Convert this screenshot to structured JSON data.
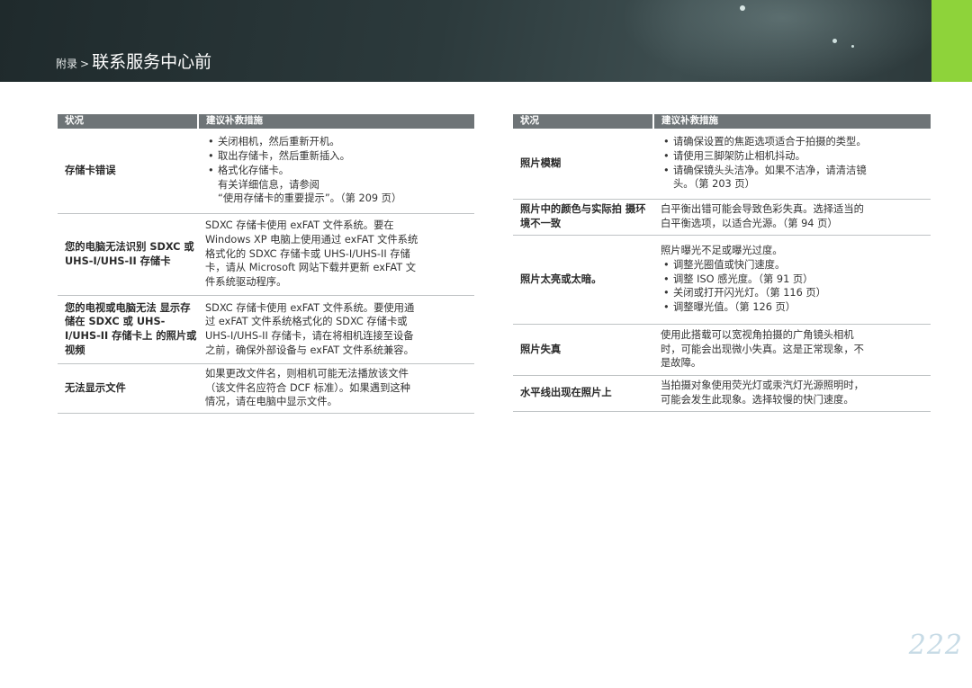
{
  "header": {
    "section": "附录",
    "separator": ">",
    "title": "联系服务中心前"
  },
  "left_table": {
    "col_condition": "状况",
    "col_solution": "建议补救措施",
    "rows": [
      {
        "condition": "存储卡错误",
        "solution": [
          "关闭相机，然后重新开机。",
          "取出存储卡，然后重新插入。",
          "格式化存储卡。",
          "有关详细信息，请参阅",
          "“使用存储卡的重要提示”。（第 209 页）"
        ]
      },
      {
        "condition": [
          "您的电脑无法识别",
          "SDXC 或 UHS-I/UHS-II",
          "存储卡"
        ],
        "solution": [
          "SDXC 存储卡使用 exFAT 文件系统。要在",
          "Windows XP 电脑上使用通过 exFAT 文件系统",
          "格式化的 SDXC 存储卡或 UHS-I/UHS-II 存储",
          "卡，请从 Microsoft 网站下载并更新 exFAT 文",
          "件系统驱动程序。"
        ]
      },
      {
        "condition": [
          "您的电视或电脑无法",
          "显示存储在 SDXC 或",
          "UHS-I/UHS-II 存储卡上",
          "的照片或视频"
        ],
        "solution": [
          "SDXC 存储卡使用 exFAT 文件系统。要使用通",
          "过 exFAT 文件系统格式化的 SDXC 存储卡或",
          "UHS-I/UHS-II 存储卡，请在将相机连接至设备",
          "之前，确保外部设备与 exFAT 文件系统兼容。"
        ]
      },
      {
        "condition": "无法显示文件",
        "solution": [
          "如果更改文件名，则相机可能无法播放该文件",
          "（该文件名应符合 DCF 标准）。如果遇到这种",
          "情况，请在电脑中显示文件。"
        ]
      }
    ]
  },
  "right_table": {
    "col_condition": "状况",
    "col_solution": "建议补救措施",
    "rows": [
      {
        "condition": "照片模糊",
        "solution": [
          "请确保设置的焦距选项适合于拍摄的类型。",
          "请使用三脚架防止相机抖动。",
          "请确保镜头头洁净。如果不洁净，请清洁镜",
          "头。（第 203 页）"
        ]
      },
      {
        "condition": [
          "照片中的颜色与实际拍",
          "摄环境不一致"
        ],
        "solution": [
          "白平衡出错可能会导致色彩失真。选择适当的",
          "白平衡选项，以适合光源。（第 94 页）"
        ]
      },
      {
        "condition": "照片太亮或太暗。",
        "solution": [
          "照片曝光不足或曝光过度。",
          "调整光圈值或快门速度。",
          "调整 ISO 感光度。（第 91 页）",
          "关闭或打开闪光灯。（第 116 页）",
          "调整曝光值。（第 126 页）"
        ]
      },
      {
        "condition": "照片失真",
        "solution": [
          "使用此搭载可以宽视角拍摄的广角镜头相机",
          "时，可能会出现微小失真。这是正常现象，不",
          "是故障。"
        ]
      },
      {
        "condition": "水平线出现在照片上",
        "solution": [
          "当拍摄对象使用荧光灯或汞汽灯光源照明时，",
          "可能会发生此现象。选择较慢的快门速度。"
        ]
      }
    ]
  },
  "page_number": "222",
  "colors": {
    "header_bg": "#2c3a3c",
    "accent": "#8ed33a",
    "table_header": "#6e7477",
    "page_number": "#c7dbe6"
  }
}
